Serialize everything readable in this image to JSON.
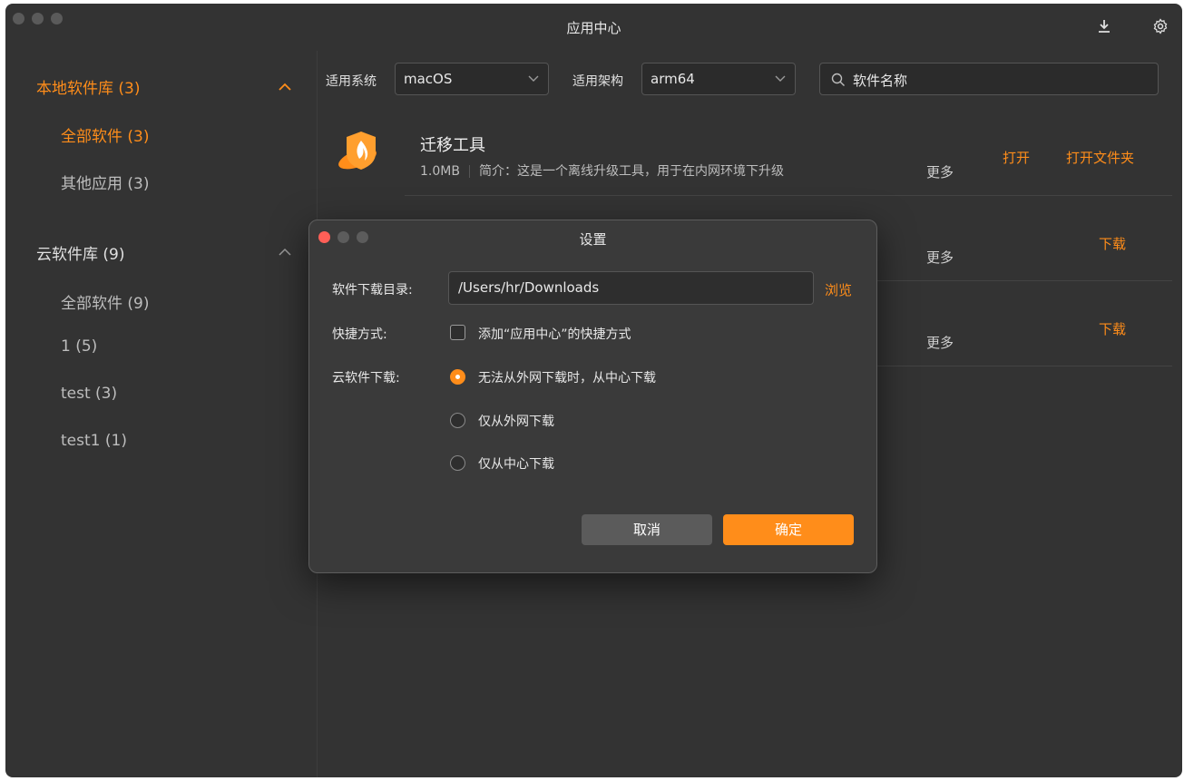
{
  "window": {
    "title": "应用中心"
  },
  "sidebar": {
    "local_group": "本地软件库 (3)",
    "local_items": [
      "全部软件 (3)",
      "其他应用 (3)"
    ],
    "cloud_group": "云软件库 (9)",
    "cloud_items": [
      "全部软件 (9)",
      "1 (5)",
      "test (3)",
      "test1 (1)"
    ]
  },
  "filters": {
    "system_label": "适用系统",
    "system_value": "macOS",
    "arch_label": "适用架构",
    "arch_value": "arm64",
    "search_placeholder": "软件名称"
  },
  "apps": [
    {
      "name": "迁移工具",
      "size": "1.0MB",
      "desc": "简介：这是一个离线升级工具，用于在内网环境下升级",
      "more": "更多",
      "action1": "打开",
      "action2": "打开文件夹"
    },
    {
      "more": "更多",
      "action1": "下载"
    },
    {
      "more": "更多",
      "action1": "下载"
    }
  ],
  "dialog": {
    "title": "设置",
    "dir_label": "软件下载目录:",
    "dir_value": "/Users/hr/Downloads",
    "browse": "浏览",
    "shortcut_label": "快捷方式:",
    "shortcut_option": "添加“应用中心”的快捷方式",
    "cloud_label": "云软件下载:",
    "cloud_options": [
      "无法从外网下载时，从中心下载",
      "仅从外网下载",
      "仅从中心下载"
    ],
    "cancel": "取消",
    "confirm": "确定"
  },
  "colors": {
    "accent": "#ff8d1a",
    "background": "#333333",
    "dialog": "#3a3a3a"
  }
}
